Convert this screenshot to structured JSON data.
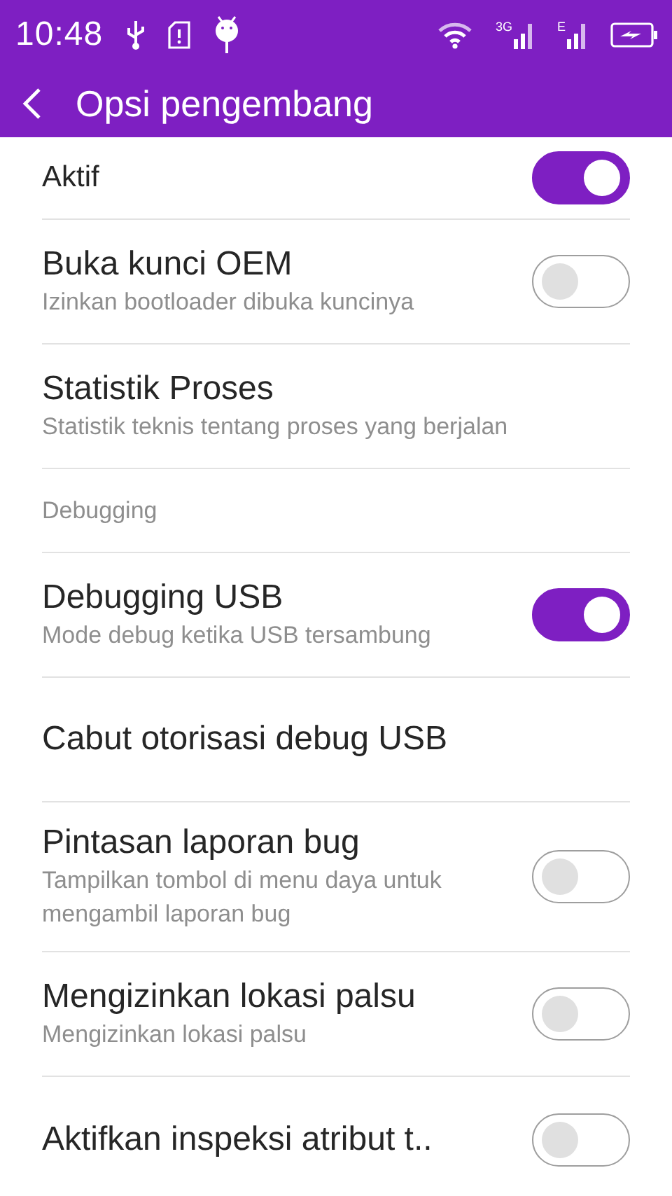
{
  "status_bar": {
    "time": "10:48",
    "network_labels": [
      "3G",
      "E"
    ]
  },
  "app_bar": {
    "title": "Opsi pengembang"
  },
  "items": [
    {
      "kind": "master",
      "title": "Aktif",
      "on": true
    },
    {
      "kind": "toggle",
      "title": "Buka kunci OEM",
      "subtitle": "Izinkan bootloader dibuka kuncinya",
      "on": false
    },
    {
      "kind": "plain",
      "title": "Statistik Proses",
      "subtitle": "Statistik teknis tentang proses yang berjalan"
    },
    {
      "kind": "header",
      "title": "Debugging"
    },
    {
      "kind": "toggle",
      "title": "Debugging USB",
      "subtitle": "Mode debug ketika USB tersambung",
      "on": true
    },
    {
      "kind": "plain",
      "title": "Cabut otorisasi debug USB"
    },
    {
      "kind": "toggle",
      "title": "Pintasan laporan bug",
      "subtitle": "Tampilkan tombol di menu daya untuk mengambil laporan bug",
      "on": false
    },
    {
      "kind": "toggle",
      "title": "Mengizinkan lokasi palsu",
      "subtitle": "Mengizinkan lokasi palsu",
      "on": false
    },
    {
      "kind": "toggle",
      "title": "Aktifkan inspeksi atribut t..",
      "on": false
    }
  ]
}
